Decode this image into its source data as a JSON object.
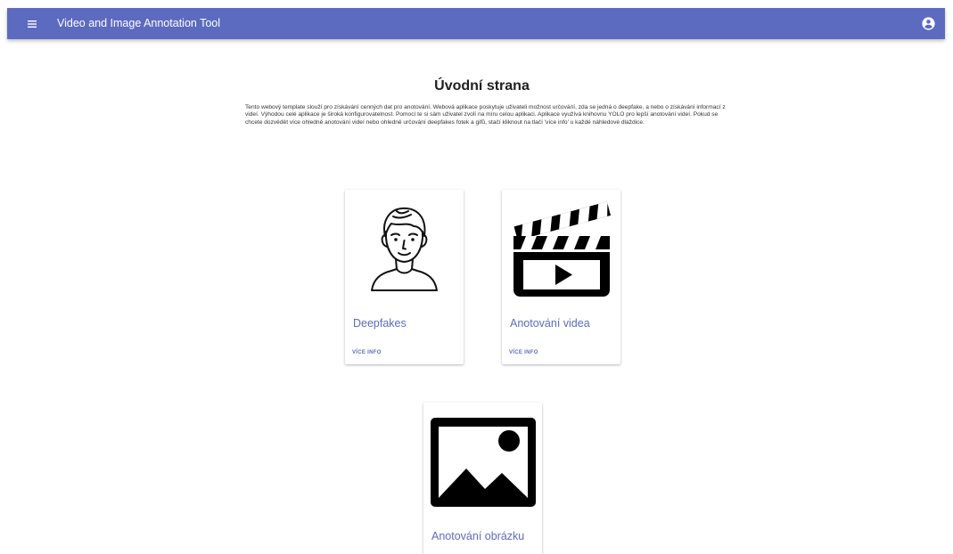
{
  "app_bar": {
    "title": "Video and Image Annotation Tool",
    "menu_icon": "menu-icon",
    "account_icon": "account-circle-icon",
    "color": "#5c6bc0"
  },
  "main": {
    "title": "Úvodní strana",
    "intro": "Tento webový template slouží pro získávání cenných dat pro anotování. Webová aplikace poskytuje uživateli možnost určování, zda se jedná o deepfake, a nebo o získávání informací z videí. Výhodou celé aplikace je široká konfigurovatelnost. Pomocí te si sám uživatel zvolí na míru celou aplikaci. Aplikace využívá knihovnu YOLO pro lepší anotování videí. Pokud se chcete dozvědět více ohledně anotování videí nebo ohledně určování deepfakes fotek a gifů, stačí kliknout na tlačí 'více info' u každé náhledové dlaždice."
  },
  "cards": [
    {
      "title": "Deepfakes",
      "action": "VÍCE INFO",
      "icon": "person-face-icon"
    },
    {
      "title": "Anotování videa",
      "action": "VÍCE INFO",
      "icon": "clapperboard-icon"
    },
    {
      "title": "Anotování obrázku",
      "icon": "image-icon"
    }
  ]
}
